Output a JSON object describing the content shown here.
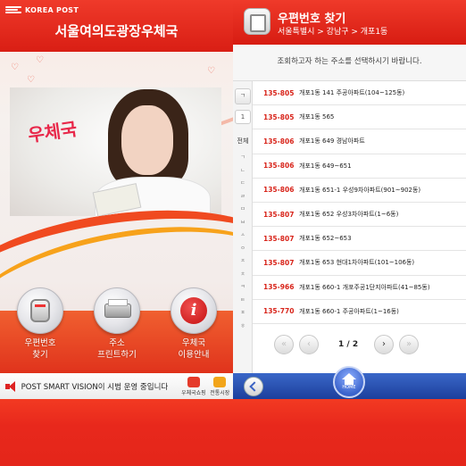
{
  "left": {
    "brand": "KOREA POST",
    "title": "서울여의도광장우체국",
    "photo_text": "우체국",
    "menu": [
      {
        "label_line1": "우편번호",
        "label_line2": "찾기",
        "icon": "mailbox-icon"
      },
      {
        "label_line1": "주소",
        "label_line2": "프린트하기",
        "icon": "printer-icon"
      },
      {
        "label_line1": "우체국",
        "label_line2": "이용안내",
        "icon": "info-icon"
      }
    ],
    "ticker": {
      "message": "POST SMART VISION이 시범 운영 중입니다",
      "btn_shop": "우체국쇼핑",
      "btn_market": "전통시장"
    }
  },
  "right": {
    "title": "우편번호 찾기",
    "breadcrumb": "서울특별시 > 강남구 > 개포1동",
    "instruction": "조회하고자 하는 주소를 선택하시기 바랍니다.",
    "index": {
      "selected_char": "ㄱ",
      "one": "1",
      "all": "전체",
      "consonants": [
        "ㄱ",
        "ㄴ",
        "ㄷ",
        "ㄹ",
        "ㅁ",
        "ㅂ",
        "ㅅ",
        "ㅇ",
        "ㅈ",
        "ㅊ",
        "ㅋ",
        "ㅌ",
        "ㅍ",
        "ㅎ"
      ]
    },
    "rows": [
      {
        "code": "135-805",
        "address": "개포1동 141 주공아파트(104~125동)"
      },
      {
        "code": "135-805",
        "address": "개포1동 565"
      },
      {
        "code": "135-806",
        "address": "개포1동 649 경남아파트"
      },
      {
        "code": "135-806",
        "address": "개포1동 649~651"
      },
      {
        "code": "135-806",
        "address": "개포1동 651-1 우성9차아파트(901~902동)"
      },
      {
        "code": "135-807",
        "address": "개포1동 652 우성3차아파트(1~6동)"
      },
      {
        "code": "135-807",
        "address": "개포1동 652~653"
      },
      {
        "code": "135-807",
        "address": "개포1동 653 현대1차아파트(101~106동)"
      },
      {
        "code": "135-966",
        "address": "개포1동 660-1 개포주공1단지아파트(41~85동)"
      },
      {
        "code": "135-770",
        "address": "개포1동 660-1 주공아파트(1~16동)"
      }
    ],
    "pager": {
      "text": "1 / 2",
      "first": "«",
      "prev": "‹",
      "next": "›",
      "last": "»"
    },
    "footer": {
      "home_label": "HOME"
    }
  },
  "colors": {
    "brand_red": "#e0231c",
    "code_red": "#d8241a",
    "footer_blue": "#2a4fb3"
  }
}
